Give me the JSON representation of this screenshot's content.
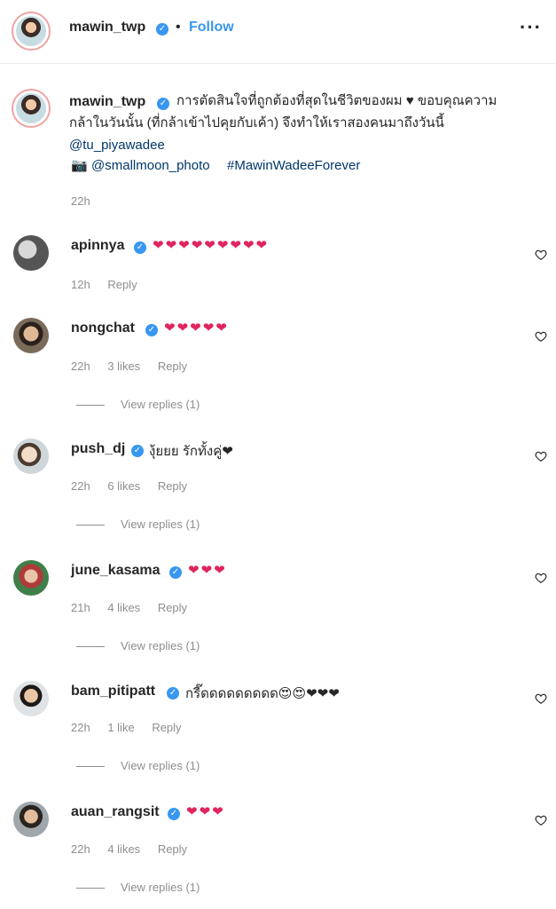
{
  "header": {
    "username": "mawin_twp",
    "dot": "•",
    "follow_label": "Follow",
    "more_label": "···"
  },
  "caption": {
    "username": "mawin_twp",
    "line1": "การตัดสินใจที่ถูกต้องที่สุดในชีวิตของผม ♥ ขอบคุณความ",
    "line2": "กล้าในวันนั้น (ที่กล้าเข้าไปคุยกับเค้า) จึงทำให้เราสองคนมาถึงวันนี้",
    "mention": "@tu_piyawadee",
    "camera": "📷",
    "photo_credit": "@smallmoon_photo",
    "hashtag": "#MawinWadeeForever",
    "time": "22h"
  },
  "comments": [
    {
      "username": "apinnya",
      "text": "❤❤❤❤❤❤❤❤❤",
      "time": "12h",
      "likes": "",
      "reply": "Reply",
      "view_replies": ""
    },
    {
      "username": "nongchat",
      "text": "❤❤❤❤❤",
      "time": "22h",
      "likes": "3 likes",
      "reply": "Reply",
      "view_replies": "View replies (1)"
    },
    {
      "username": "push_dj",
      "text": "งุ้ยยย รักทั้งคู่❤",
      "time": "22h",
      "likes": "6 likes",
      "reply": "Reply",
      "view_replies": "View replies (1)"
    },
    {
      "username": "june_kasama",
      "text": "❤❤❤",
      "time": "21h",
      "likes": "4 likes",
      "reply": "Reply",
      "view_replies": "View replies (1)"
    },
    {
      "username": "bam_pitipatt",
      "text": "กรี๊ดดดดดดดดด😍😍❤❤❤",
      "time": "22h",
      "likes": "1 like",
      "reply": "Reply",
      "view_replies": "View replies (1)"
    },
    {
      "username": "auan_rangsit",
      "text": "❤❤❤",
      "time": "22h",
      "likes": "4 likes",
      "reply": "Reply",
      "view_replies": "View replies (1)"
    }
  ],
  "colors": {
    "link": "#00376b",
    "follow": "#3897f0",
    "muted": "#8e8e8e",
    "heart": "#e0245e"
  },
  "icons": {
    "verified": "verified-badge-icon",
    "like": "heart-outline-icon"
  }
}
